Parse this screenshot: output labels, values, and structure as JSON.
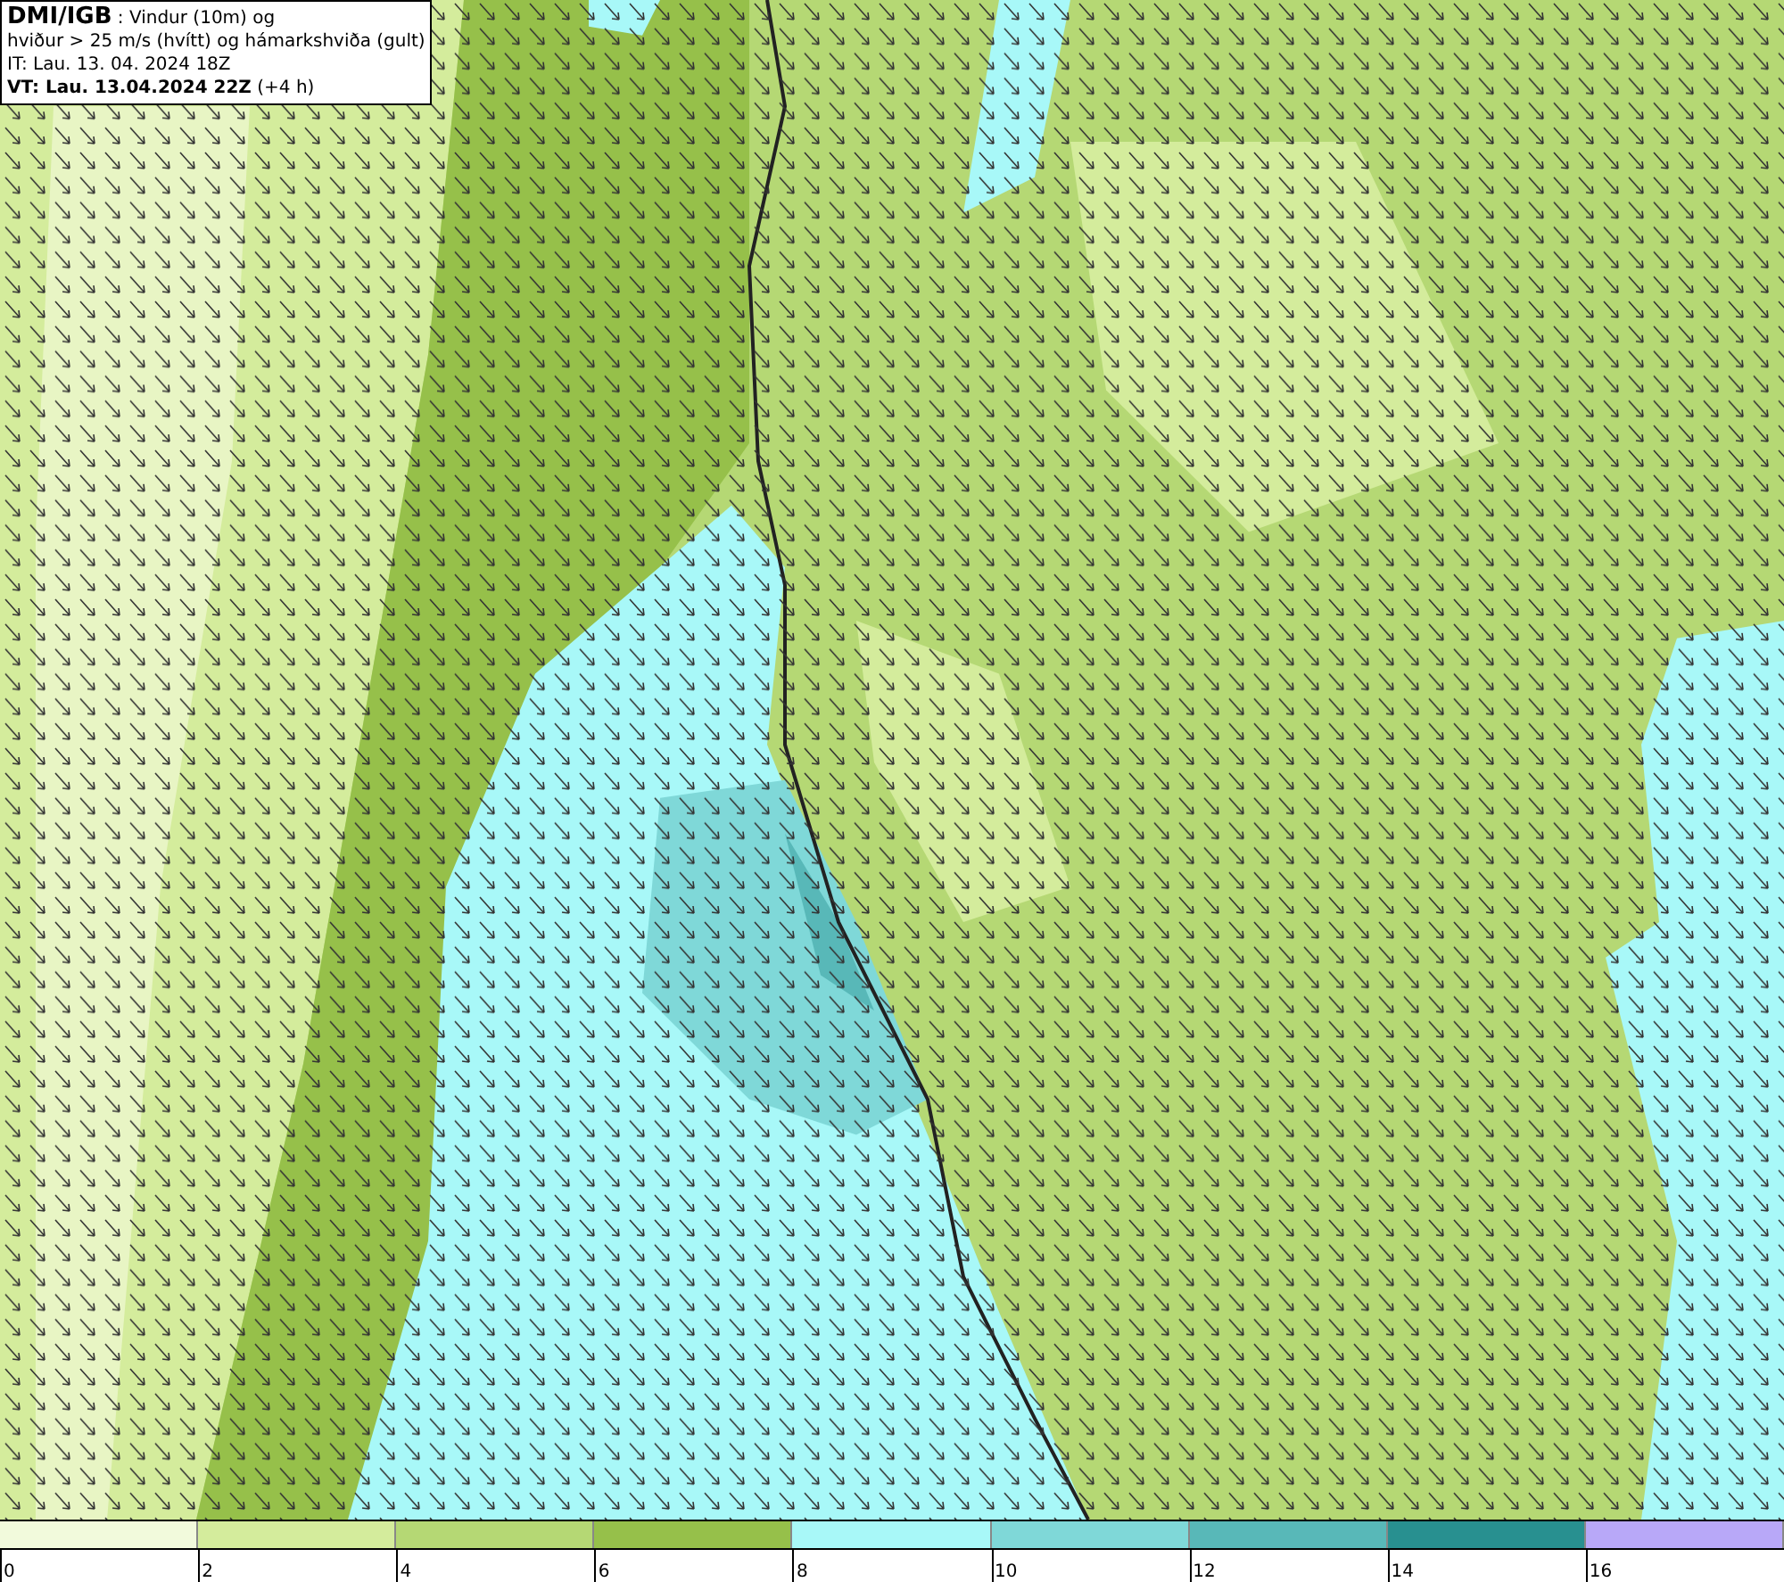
{
  "header": {
    "lines": [
      {
        "text": "**DMI/IGB** : Vindur (10m) og"
      },
      {
        "text": "hviður > 25 m/s (hvítt) og hámarkshviða (gult)"
      },
      {
        "text": "IT: Lau. 13. 04. 2024 18Z"
      },
      {
        "text": "**VT: Lau. 13.04.2024 22Z** (+4 h)"
      }
    ]
  },
  "legend": {
    "bins": [
      {
        "label": "0",
        "color": "#f2fadc"
      },
      {
        "label": "2",
        "color": "#d4ec9c"
      },
      {
        "label": "4",
        "color": "#b5d874"
      },
      {
        "label": "6",
        "color": "#96c04a"
      },
      {
        "label": "8",
        "color": "#a8f8f8"
      },
      {
        "label": "10",
        "color": "#7fd8d8"
      },
      {
        "label": "12",
        "color": "#58b8b8"
      },
      {
        "label": "14",
        "color": "#289090"
      },
      {
        "label": "16",
        "color": "#b8a8f8"
      }
    ]
  }
}
